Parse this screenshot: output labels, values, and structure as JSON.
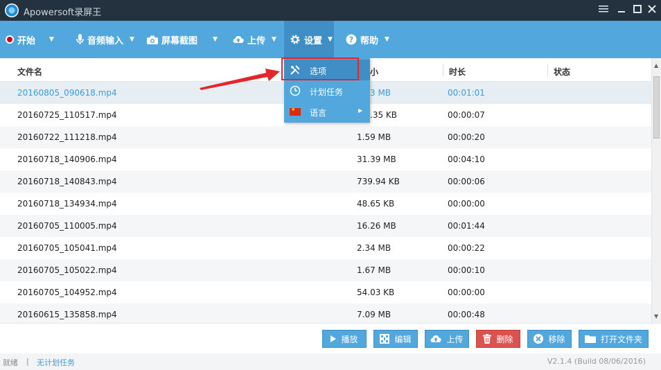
{
  "window": {
    "title": "Apowersoft录屏王",
    "menu_icon": "menu-lines-icon",
    "minimize_icon": "minimize-icon",
    "maximize_icon": "maximize-icon",
    "close_icon": "close-icon"
  },
  "toolbar": {
    "start": "开始",
    "audio_input": "音频输入",
    "screenshot": "屏幕截图",
    "upload": "上传",
    "settings": "设置",
    "help": "帮助"
  },
  "table": {
    "headers": {
      "name": "文件名",
      "size": "小",
      "duration": "时长",
      "status": "状态"
    },
    "rows": [
      {
        "name": "20160805_090618.mp4",
        "size": "3 MB",
        "duration": "00:01:01"
      },
      {
        "name": "20160725_110517.mp4",
        "size": ".35 KB",
        "duration": "00:00:07"
      },
      {
        "name": "20160722_111218.mp4",
        "size": "1.59 MB",
        "duration": "00:00:20"
      },
      {
        "name": "20160718_140906.mp4",
        "size": "31.39 MB",
        "duration": "00:04:10"
      },
      {
        "name": "20160718_140843.mp4",
        "size": "739.94 KB",
        "duration": "00:00:06"
      },
      {
        "name": "20160718_134934.mp4",
        "size": "48.65 KB",
        "duration": "00:00:00"
      },
      {
        "name": "20160705_110005.mp4",
        "size": "16.26 MB",
        "duration": "00:01:44"
      },
      {
        "name": "20160705_105041.mp4",
        "size": "2.34 MB",
        "duration": "00:00:22"
      },
      {
        "name": "20160705_105022.mp4",
        "size": "1.67 MB",
        "duration": "00:00:10"
      },
      {
        "name": "20160705_104952.mp4",
        "size": "54.03 KB",
        "duration": "00:00:00"
      },
      {
        "name": "20160615_135858.mp4",
        "size": "7.09 MB",
        "duration": "00:00:48"
      }
    ]
  },
  "settings_menu": {
    "options": "选项",
    "schedule": "计划任务",
    "language": "语言"
  },
  "actions": {
    "play": "播放",
    "edit": "编辑",
    "upload": "上传",
    "delete": "删除",
    "remove": "移除",
    "open_folder": "打开文件夹"
  },
  "status": {
    "ready": "就绪",
    "separator": "|",
    "no_schedule": "无计划任务",
    "version": "V2.1.4 (Build 08/06/2016)"
  },
  "colors": {
    "toolbar": "#52a8dd",
    "titlebar": "#24323f",
    "highlight": "#e3262c",
    "delete_button": "#d9534f",
    "selected_text": "#3e9bd3"
  }
}
